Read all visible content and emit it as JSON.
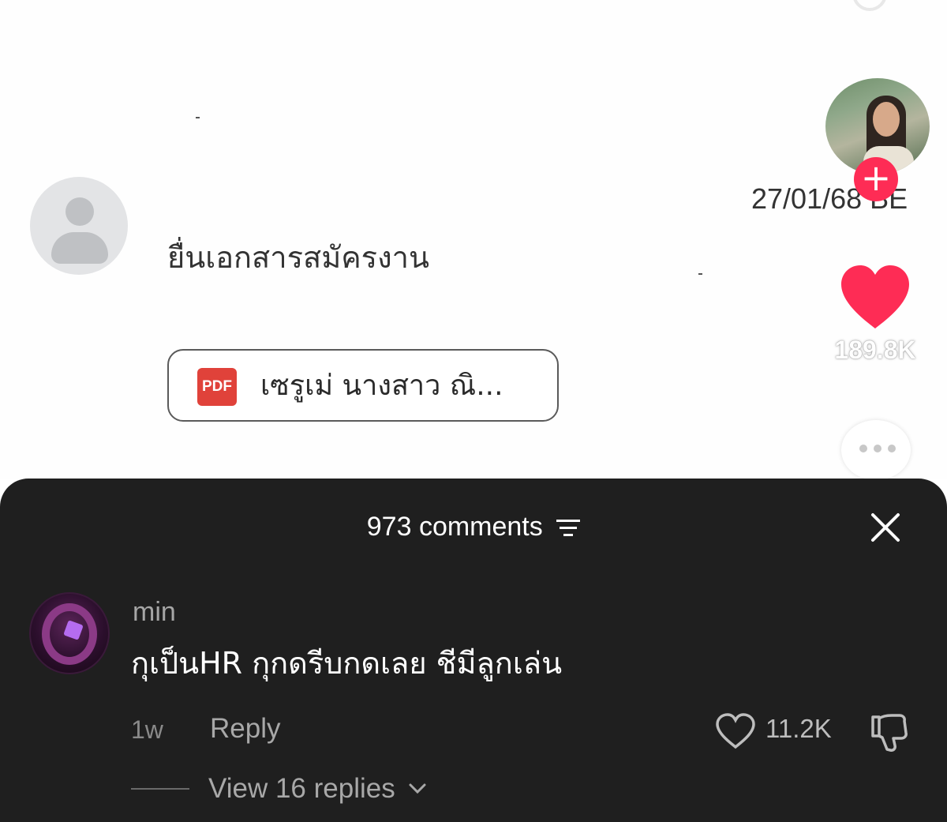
{
  "post": {
    "document_title": "ยื่นเอกสารสมัครงาน",
    "attachment": {
      "icon_label": "PDF",
      "file_name": "เซรูเม่ นางสาว ณิ..."
    }
  },
  "rail": {
    "creator_avatar": "creator-photo",
    "follow_label": "+",
    "date": "27/01/68 BE",
    "like_count": "189.8K",
    "heart_color": "#fe2c55"
  },
  "comments": {
    "header": "973 comments",
    "items": [
      {
        "username": "min",
        "text": "กุเป็นHR กุกดรีบกดเลย ชีมีลูกเล่น",
        "time": "1w",
        "reply_label": "Reply",
        "like_count": "11.2K",
        "view_replies": "View 16 replies"
      }
    ]
  },
  "colors": {
    "sheet_bg": "#1f1f1f",
    "accent": "#fe2c55",
    "pdf_red": "#e0423a"
  }
}
